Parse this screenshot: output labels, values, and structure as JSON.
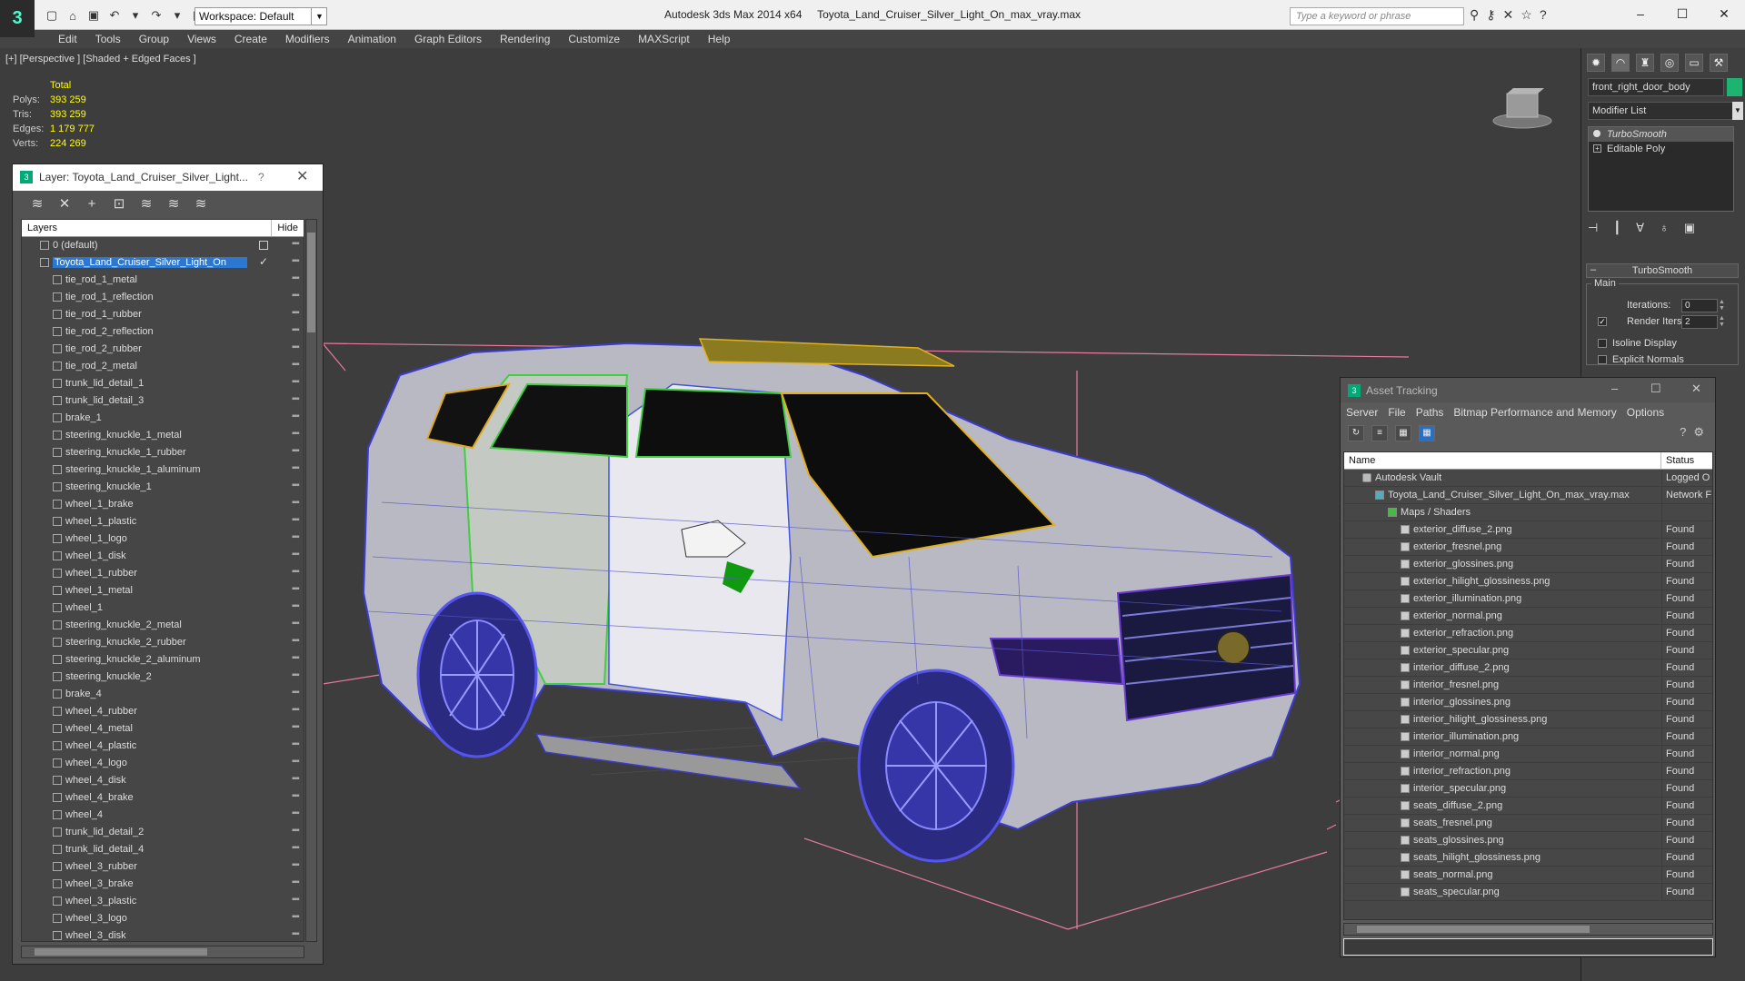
{
  "titlebar": {
    "app_logo": "3",
    "workspace": "Workspace: Default",
    "app_name": "Autodesk 3ds Max  2014 x64",
    "file_name": "Toyota_Land_Cruiser_Silver_Light_On_max_vray.max",
    "search_placeholder": "Type a keyword or phrase"
  },
  "menu": [
    "Edit",
    "Tools",
    "Group",
    "Views",
    "Create",
    "Modifiers",
    "Animation",
    "Graph Editors",
    "Rendering",
    "Customize",
    "MAXScript",
    "Help"
  ],
  "viewport": {
    "label": "[+] [Perspective ] [Shaded + Edged Faces ]",
    "stats": {
      "header": "Total",
      "rows": [
        {
          "k": "Polys:",
          "v": "393 259"
        },
        {
          "k": "Tris:",
          "v": "393 259"
        },
        {
          "k": "Edges:",
          "v": "1 179 777"
        },
        {
          "k": "Verts:",
          "v": "224 269"
        }
      ]
    }
  },
  "layer_dialog": {
    "title": "Layer: Toyota_Land_Cruiser_Silver_Light...",
    "help": "?",
    "col_layers": "Layers",
    "col_hide": "Hide",
    "default_layer": "0 (default)",
    "active_layer": "Toyota_Land_Cruiser_Silver_Light_On",
    "objects": [
      "tie_rod_1_metal",
      "tie_rod_1_reflection",
      "tie_rod_1_rubber",
      "tie_rod_2_reflection",
      "tie_rod_2_rubber",
      "tie_rod_2_metal",
      "trunk_lid_detail_1",
      "trunk_lid_detail_3",
      "brake_1",
      "steering_knuckle_1_metal",
      "steering_knuckle_1_rubber",
      "steering_knuckle_1_aluminum",
      "steering_knuckle_1",
      "wheel_1_brake",
      "wheel_1_plastic",
      "wheel_1_logo",
      "wheel_1_disk",
      "wheel_1_rubber",
      "wheel_1_metal",
      "wheel_1",
      "steering_knuckle_2_metal",
      "steering_knuckle_2_rubber",
      "steering_knuckle_2_aluminum",
      "steering_knuckle_2",
      "brake_4",
      "wheel_4_rubber",
      "wheel_4_metal",
      "wheel_4_plastic",
      "wheel_4_logo",
      "wheel_4_disk",
      "wheel_4_brake",
      "wheel_4",
      "trunk_lid_detail_2",
      "trunk_lid_detail_4",
      "wheel_3_rubber",
      "wheel_3_brake",
      "wheel_3_plastic",
      "wheel_3_logo",
      "wheel_3_disk"
    ]
  },
  "command_panel": {
    "object_name": "front_right_door_body",
    "object_color": "#1db371",
    "modifier_list": "Modifier List",
    "stack": [
      "TurboSmooth",
      "Editable Poly"
    ],
    "rollout_title": "TurboSmooth",
    "group_main": "Main",
    "iterations_label": "Iterations:",
    "iterations_value": "0",
    "render_iters_label": "Render Iters:",
    "render_iters_value": "2",
    "isoline_label": "Isoline Display",
    "explicit_normals_label": "Explicit Normals"
  },
  "asset_tracking": {
    "title": "Asset Tracking",
    "menu": [
      "Server",
      "File",
      "Paths",
      "Bitmap Performance and Memory",
      "Options"
    ],
    "col_name": "Name",
    "col_status": "Status",
    "rows": [
      {
        "name": "Autodesk Vault",
        "status": "Logged O",
        "indent": 0,
        "icon": "vault"
      },
      {
        "name": "Toyota_Land_Cruiser_Silver_Light_On_max_vray.max",
        "status": "Network F",
        "indent": 1,
        "icon": "max"
      },
      {
        "name": "Maps / Shaders",
        "status": "",
        "indent": 2,
        "icon": "maps"
      },
      {
        "name": "exterior_diffuse_2.png",
        "status": "Found",
        "indent": 3,
        "icon": "file"
      },
      {
        "name": "exterior_fresnel.png",
        "status": "Found",
        "indent": 3,
        "icon": "file"
      },
      {
        "name": "exterior_glossines.png",
        "status": "Found",
        "indent": 3,
        "icon": "file"
      },
      {
        "name": "exterior_hilight_glossiness.png",
        "status": "Found",
        "indent": 3,
        "icon": "file"
      },
      {
        "name": "exterior_illumination.png",
        "status": "Found",
        "indent": 3,
        "icon": "file"
      },
      {
        "name": "exterior_normal.png",
        "status": "Found",
        "indent": 3,
        "icon": "file"
      },
      {
        "name": "exterior_refraction.png",
        "status": "Found",
        "indent": 3,
        "icon": "file"
      },
      {
        "name": "exterior_specular.png",
        "status": "Found",
        "indent": 3,
        "icon": "file"
      },
      {
        "name": "interior_diffuse_2.png",
        "status": "Found",
        "indent": 3,
        "icon": "file"
      },
      {
        "name": "interior_fresnel.png",
        "status": "Found",
        "indent": 3,
        "icon": "file"
      },
      {
        "name": "interior_glossines.png",
        "status": "Found",
        "indent": 3,
        "icon": "file"
      },
      {
        "name": "interior_hilight_glossiness.png",
        "status": "Found",
        "indent": 3,
        "icon": "file"
      },
      {
        "name": "interior_illumination.png",
        "status": "Found",
        "indent": 3,
        "icon": "file"
      },
      {
        "name": "interior_normal.png",
        "status": "Found",
        "indent": 3,
        "icon": "file"
      },
      {
        "name": "interior_refraction.png",
        "status": "Found",
        "indent": 3,
        "icon": "file"
      },
      {
        "name": "interior_specular.png",
        "status": "Found",
        "indent": 3,
        "icon": "file"
      },
      {
        "name": "seats_diffuse_2.png",
        "status": "Found",
        "indent": 3,
        "icon": "file"
      },
      {
        "name": "seats_fresnel.png",
        "status": "Found",
        "indent": 3,
        "icon": "file"
      },
      {
        "name": "seats_glossines.png",
        "status": "Found",
        "indent": 3,
        "icon": "file"
      },
      {
        "name": "seats_hilight_glossiness.png",
        "status": "Found",
        "indent": 3,
        "icon": "file"
      },
      {
        "name": "seats_normal.png",
        "status": "Found",
        "indent": 3,
        "icon": "file"
      },
      {
        "name": "seats_specular.png",
        "status": "Found",
        "indent": 3,
        "icon": "file"
      }
    ]
  }
}
